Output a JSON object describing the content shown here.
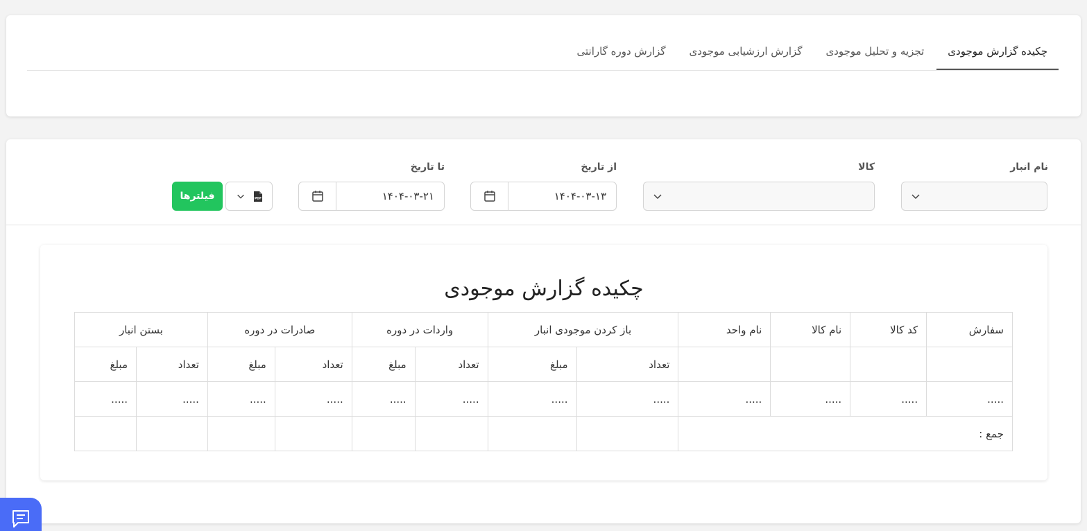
{
  "tabs": [
    {
      "label": "چکیده گزارش موجودی",
      "active": true
    },
    {
      "label": "تجزیه و تحلیل موجودی",
      "active": false
    },
    {
      "label": "گزارش ارزشیابی موجودی",
      "active": false
    },
    {
      "label": "گزارش دوره گارانتی",
      "active": false
    }
  ],
  "filters": {
    "warehouse_label": "نام انبار",
    "product_label": "کالا",
    "from_date_label": "از تاریخ",
    "from_date_value": "۱۴۰۴-۰۳-۱۳",
    "to_date_label": "تا تاریخ",
    "to_date_value": "۱۴۰۴-۰۳-۲۱",
    "filters_button": "فیلترها",
    "export_icon": "pdf-file-icon"
  },
  "report": {
    "title": "چکیده گزارش موجودی",
    "headers": {
      "order": "سفارش",
      "product_code": "کد کالا",
      "product_name": "نام کالا",
      "unit_name": "نام واحد",
      "opening": "باز کردن موجودی انبار",
      "inbound": "واردات در دوره",
      "outbound": "صادرات در دوره",
      "closing": "بستن انبار"
    },
    "sub": {
      "qty": "تعداد",
      "amount": "مبلغ"
    },
    "placeholder": ".....",
    "total_label": "جمع :"
  },
  "colors": {
    "accent": "#22c55e",
    "chat": "#4a6cf7"
  }
}
